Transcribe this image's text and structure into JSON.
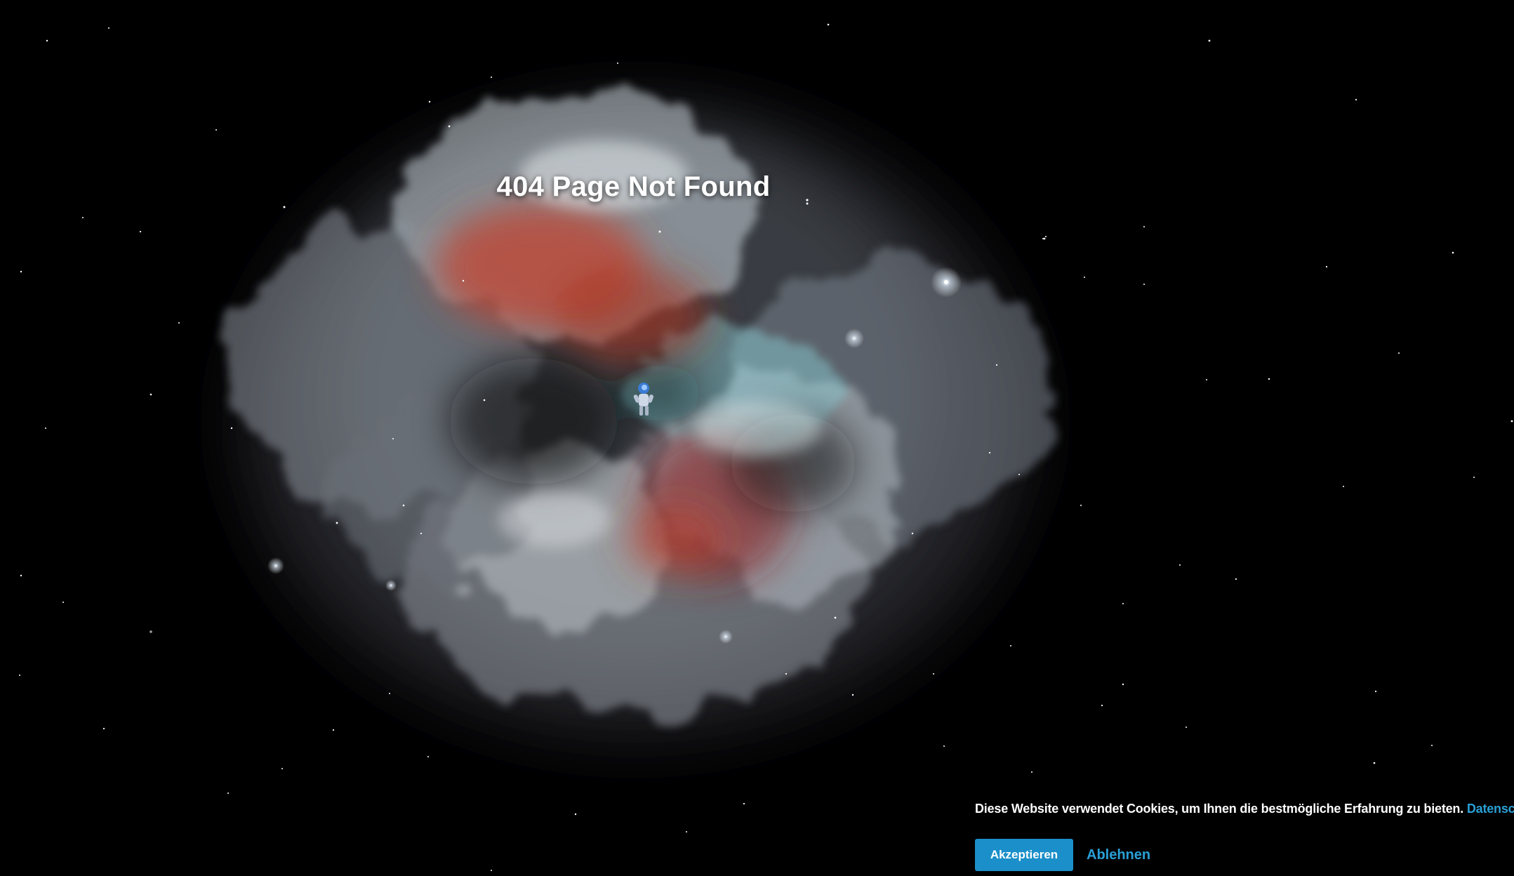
{
  "page": {
    "title": "404 Page Not Found"
  },
  "hero": {
    "illustration": "nebula-with-astronaut"
  },
  "cookie_banner": {
    "message": "Diese Website verwendet Cookies, um Ihnen die bestmögliche Erfahrung zu bieten.",
    "privacy_link": "Datenschutz",
    "accept_label": "Akzeptieren",
    "decline_label": "Ablehnen"
  },
  "colors": {
    "background": "#000000",
    "accent": "#1b8fc9",
    "link": "#2a9fd6",
    "nebula_red": "#c2402c",
    "nebula_teal": "#8ed4dc"
  }
}
